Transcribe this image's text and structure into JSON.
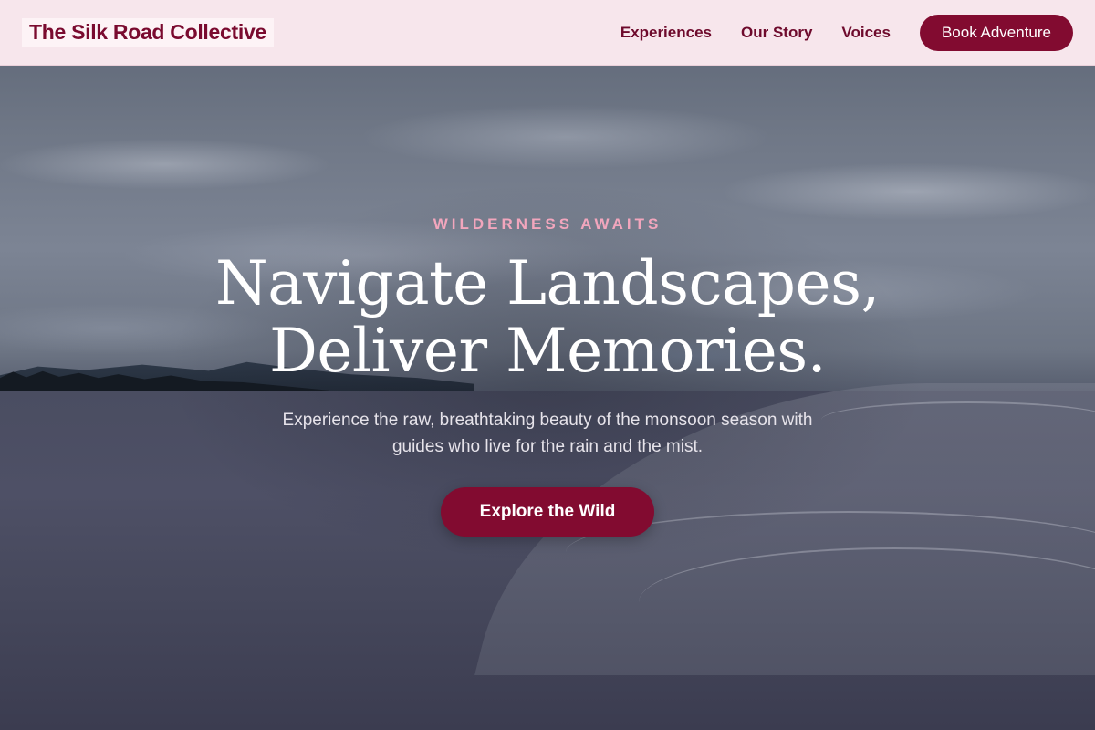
{
  "brand": {
    "name": "The Silk Road Collective"
  },
  "nav": {
    "links": [
      {
        "label": "Experiences"
      },
      {
        "label": "Our Story"
      },
      {
        "label": "Voices"
      }
    ],
    "cta_label": "Book Adventure"
  },
  "hero": {
    "eyebrow": "WILDERNESS AWAITS",
    "headline_line1": "Navigate Landscapes,",
    "headline_line2": "Deliver Memories.",
    "subtext": "Experience the raw, breathtaking beauty of the monsoon season with guides who live for the rain and the mist.",
    "cta_label": "Explore the Wild"
  },
  "colors": {
    "brand_primary": "#820b30",
    "nav_background": "#f7e6ec",
    "eyebrow_accent": "#f2a6bd"
  }
}
